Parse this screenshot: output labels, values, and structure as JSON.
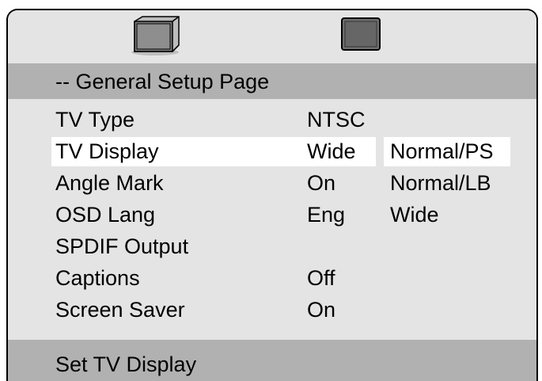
{
  "icons": {
    "tab_1": "tv-icon",
    "tab_2": "disc-icon"
  },
  "page_title": "-- General Setup Page",
  "menu": {
    "items": [
      {
        "label": "TV Type",
        "value": "NTSC"
      },
      {
        "label": "TV Display",
        "value": "Wide",
        "highlighted": true
      },
      {
        "label": "Angle Mark",
        "value": "On"
      },
      {
        "label": "OSD Lang",
        "value": "Eng"
      },
      {
        "label": "SPDIF Output",
        "value": ""
      },
      {
        "label": "Captions",
        "value": "Off"
      },
      {
        "label": "Screen Saver",
        "value": "On"
      }
    ]
  },
  "submenu": {
    "options": [
      "Normal/PS",
      "Normal/LB",
      "Wide"
    ],
    "selected": "Normal/PS"
  },
  "status": "Set TV Display",
  "colors": {
    "panel": "#e4e4e4",
    "bar": "#b1b1b1",
    "highlight": "#ffffff"
  }
}
